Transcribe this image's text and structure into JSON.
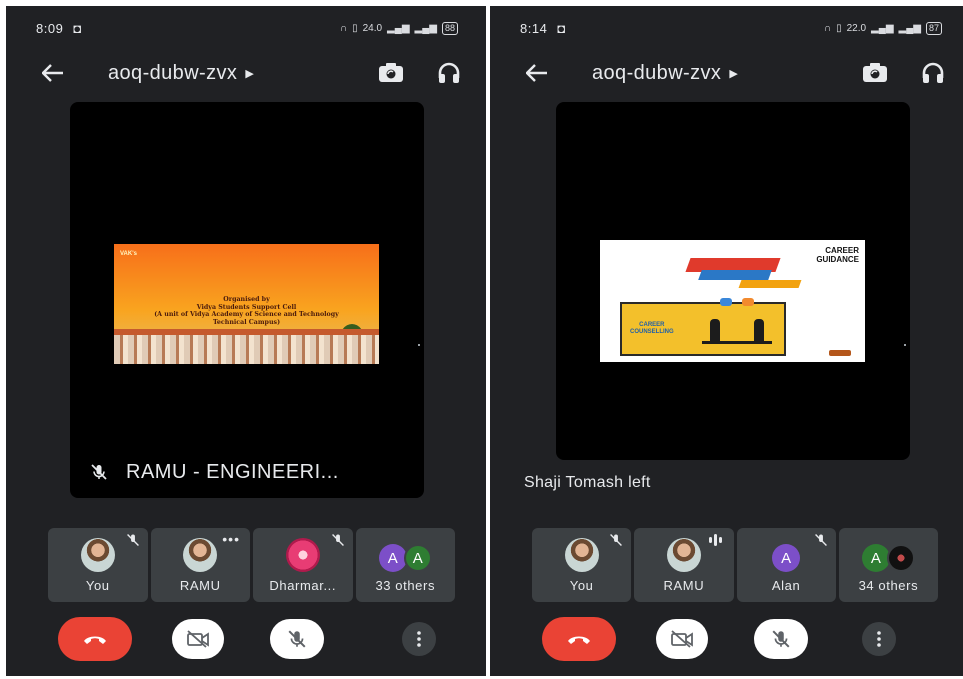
{
  "colors": {
    "background": "#202124",
    "tile": "#3c4043",
    "end_call": "#ea4335",
    "text": "#e8eaed"
  },
  "screens": [
    {
      "status_time": "8:09",
      "status_speed": "24.0",
      "battery": "88",
      "meeting_code": "aoq-dubw-zvx",
      "main_tile_name": "RAMU - ENGINEERI...",
      "slide": {
        "brand": "VAK's",
        "line1": "Organised by",
        "line2": "Vidya Students Support Cell",
        "line3": "(A unit of Vidya Academy of Science and Technology",
        "line4": "Technical Campus)"
      },
      "participants": [
        {
          "label": "You"
        },
        {
          "label": "RAMU"
        },
        {
          "label": "Dharmar..."
        },
        {
          "label": "33 others",
          "avatar_letter_1": "A",
          "avatar_letter_2": "A"
        }
      ]
    },
    {
      "status_time": "8:14",
      "status_speed": "22.0",
      "battery": "87",
      "meeting_code": "aoq-dubw-zvx",
      "notification": "Shaji Tomash left",
      "slide": {
        "title_line1": "CAREER",
        "title_line2": "GUIDANCE",
        "box_line1": "CAREER",
        "box_line2": "COUNSELLING"
      },
      "participants": [
        {
          "label": "You"
        },
        {
          "label": "RAMU"
        },
        {
          "label": "Alan",
          "avatar_letter": "A"
        },
        {
          "label": "34 others",
          "avatar_letter": "A"
        }
      ]
    }
  ]
}
